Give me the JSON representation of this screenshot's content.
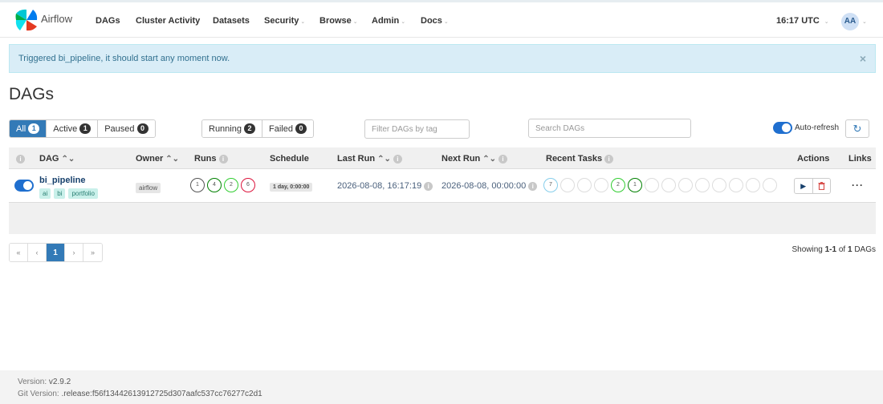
{
  "nav": {
    "brand": "Airflow",
    "items": [
      {
        "label": "DAGs",
        "dropdown": false
      },
      {
        "label": "Cluster Activity",
        "dropdown": false
      },
      {
        "label": "Datasets",
        "dropdown": false
      },
      {
        "label": "Security",
        "dropdown": true
      },
      {
        "label": "Browse",
        "dropdown": true
      },
      {
        "label": "Admin",
        "dropdown": true
      },
      {
        "label": "Docs",
        "dropdown": true
      }
    ],
    "clock": "16:17 UTC",
    "avatar": "AA"
  },
  "alert": {
    "message": "Triggered bi_pipeline, it should start any moment now.",
    "close": "×"
  },
  "page_title": "DAGs",
  "filters": {
    "status": [
      {
        "label": "All",
        "count": "1"
      },
      {
        "label": "Active",
        "count": "1"
      },
      {
        "label": "Paused",
        "count": "0"
      }
    ],
    "run_state": [
      {
        "label": "Running",
        "count": "2"
      },
      {
        "label": "Failed",
        "count": "0"
      }
    ],
    "tag_placeholder": "Filter DAGs by tag",
    "search_placeholder": "Search DAGs",
    "auto_refresh_label": "Auto-refresh"
  },
  "table": {
    "headers": {
      "dag": "DAG",
      "owner": "Owner",
      "runs": "Runs",
      "schedule": "Schedule",
      "last_run": "Last Run",
      "next_run": "Next Run",
      "recent_tasks": "Recent Tasks",
      "actions": "Actions",
      "links": "Links"
    },
    "rows": [
      {
        "dag_id": "bi_pipeline",
        "tags": [
          "ai",
          "bi",
          "portfolio"
        ],
        "owner": "airflow",
        "runs": [
          {
            "count": "1",
            "color": "#555555"
          },
          {
            "count": "4",
            "color": "#008000"
          },
          {
            "count": "2",
            "color": "#32cd32"
          },
          {
            "count": "6",
            "color": "#dc143c"
          }
        ],
        "schedule": "1 day, 0:00:00",
        "last_run": "2026-08-08, 16:17:19",
        "next_run": "2026-08-08, 00:00:00",
        "recent_tasks": [
          {
            "count": "7",
            "color": "#87ceeb"
          },
          {
            "count": "",
            "color": "#dddddd"
          },
          {
            "count": "",
            "color": "#dddddd"
          },
          {
            "count": "",
            "color": "#dddddd"
          },
          {
            "count": "2",
            "color": "#32cd32"
          },
          {
            "count": "1",
            "color": "#008000"
          },
          {
            "count": "",
            "color": "#dddddd"
          },
          {
            "count": "",
            "color": "#dddddd"
          },
          {
            "count": "",
            "color": "#dddddd"
          },
          {
            "count": "",
            "color": "#dddddd"
          },
          {
            "count": "",
            "color": "#dddddd"
          },
          {
            "count": "",
            "color": "#dddddd"
          },
          {
            "count": "",
            "color": "#dddddd"
          },
          {
            "count": "",
            "color": "#dddddd"
          }
        ],
        "actions": {
          "trigger_icon": "play-icon",
          "delete_icon": "trash-icon"
        },
        "links": "···"
      }
    ]
  },
  "pagination": {
    "first": "«",
    "prev": "‹",
    "current": "1",
    "next": "›",
    "last": "»"
  },
  "showing": {
    "prefix": "Showing ",
    "range": "1-1",
    "of": " of ",
    "total": "1",
    "suffix": " DAGs"
  },
  "footer": {
    "version_label": "Version: ",
    "version": "v2.9.2",
    "git_label": "Git Version: ",
    "git_version": ".release:f56f13442613912725d307aafc537cc76277c2d1"
  }
}
